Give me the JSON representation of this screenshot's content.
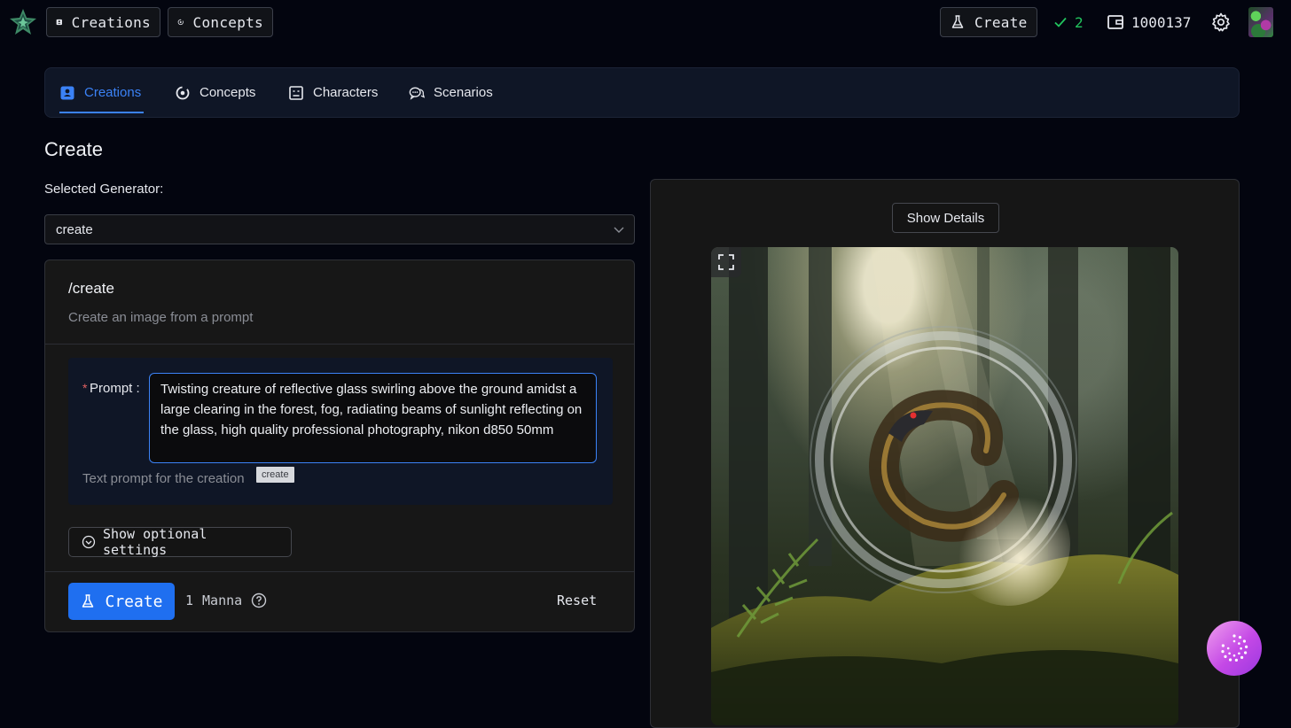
{
  "topbar": {
    "creations_label": "Creations",
    "concepts_label": "Concepts",
    "create_label": "Create",
    "completed_count": "2",
    "balance": "1000137"
  },
  "tabs": [
    {
      "label": "Creations",
      "active": true
    },
    {
      "label": "Concepts",
      "active": false
    },
    {
      "label": "Characters",
      "active": false
    },
    {
      "label": "Scenarios",
      "active": false
    }
  ],
  "main": {
    "title": "Create",
    "generator_label": "Selected Generator:",
    "generator_value": "create",
    "card": {
      "title": "/create",
      "subtitle": "Create an image from a prompt",
      "required_mark": "*",
      "prompt_label": "Prompt",
      "prompt_colon": ":",
      "prompt_value": "Twisting creature of reflective glass swirling above the ground amidst a large clearing in the forest, fog, radiating beams of sunlight reflecting on the glass, high quality professional photography, nikon d850 50mm",
      "prompt_hint": "Text prompt for the creation",
      "prompt_tag": "create",
      "optional_settings_label": "Show optional settings",
      "create_label": "Create",
      "cost_amount": "1",
      "cost_unit": "Manna",
      "reset_label": "Reset"
    }
  },
  "preview": {
    "details_label": "Show Details"
  },
  "colors": {
    "accent": "#3b82f6",
    "primary_button": "#1f6ff0",
    "success": "#22c55e",
    "required": "#e06060"
  },
  "icons": {
    "logo": "star-logo-icon",
    "creations": "creations-icon",
    "concepts": "concepts-icon",
    "characters": "characters-icon",
    "scenarios": "chat-bubbles-icon",
    "create": "flask-icon",
    "check": "check-icon",
    "wallet": "wallet-icon",
    "settings": "gear-icon"
  }
}
